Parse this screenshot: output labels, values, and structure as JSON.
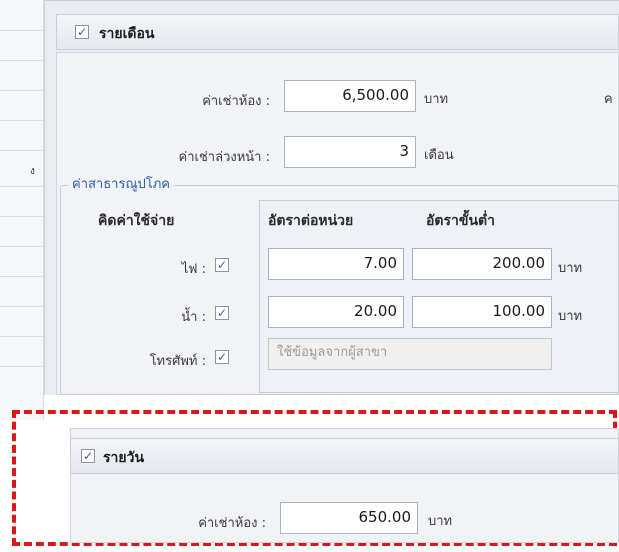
{
  "left_table": {
    "row_text": "ง"
  },
  "monthly": {
    "checked": true,
    "title": "รายเดือน",
    "room_rent": {
      "label": "ค่าเช่าห้อง :",
      "value": "6,500.00",
      "unit": "บาท"
    },
    "advance_rent": {
      "label": "ค่าเช่าล่วงหน้า :",
      "value": "3",
      "unit": "เดือน"
    },
    "right_cut_label": "ค"
  },
  "utilities": {
    "legend": "ค่าสาธารณูปโภค",
    "col_charge": "คิดค่าใช้จ่าย",
    "col_rate": "อัตราต่อหน่วย",
    "col_min": "อัตราขั้นต่ำ",
    "rows": [
      {
        "label": "ไฟ :",
        "checked": true,
        "rate": "7.00",
        "min": "200.00",
        "unit": "บาท"
      },
      {
        "label": "น้ำ :",
        "checked": true,
        "rate": "20.00",
        "min": "100.00",
        "unit": "บาท"
      },
      {
        "label": "โทรศัพท์ :",
        "checked": true,
        "placeholder": "ใช้ข้อมูลจากผู้สาขา"
      }
    ]
  },
  "daily": {
    "checked": true,
    "title": "รายวัน",
    "room_rent": {
      "label": "ค่าเช่าห้อง :",
      "value": "650.00",
      "unit": "บาท"
    }
  },
  "colors": {
    "accent": "#2b5fa8",
    "highlight": "#d7191c"
  }
}
